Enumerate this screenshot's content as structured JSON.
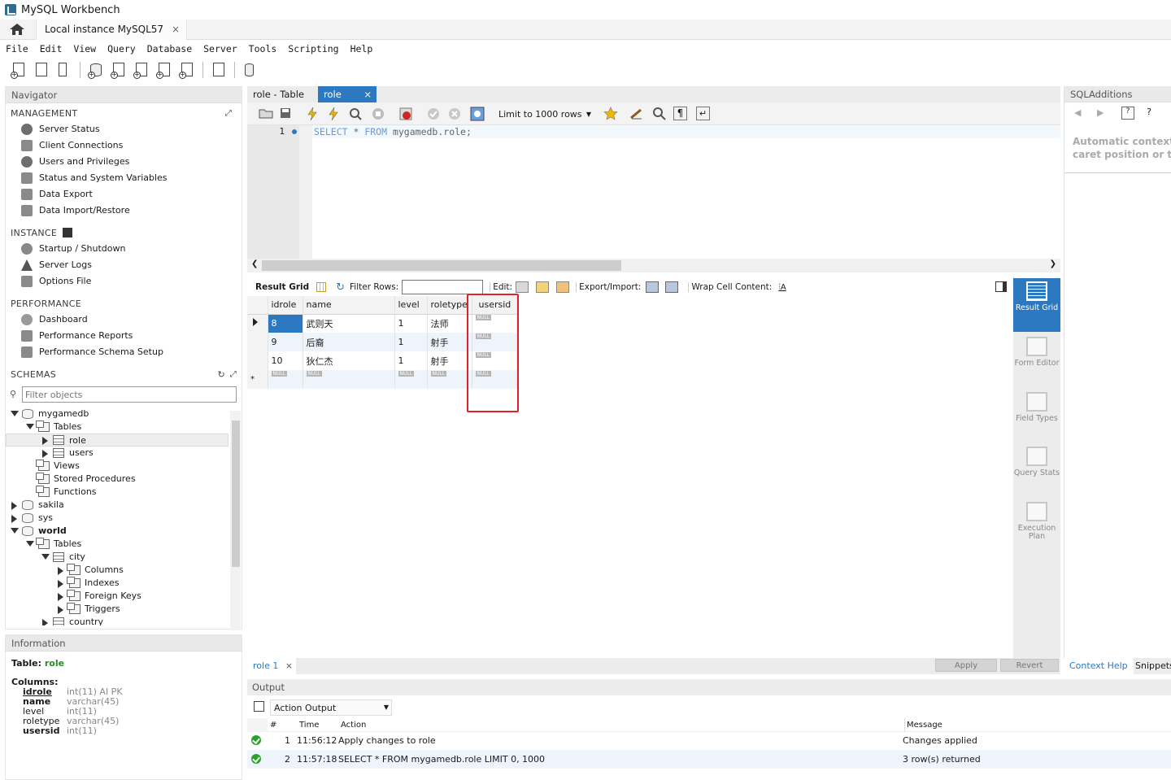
{
  "window": {
    "title": "MySQL Workbench"
  },
  "tabs": {
    "instance": "Local instance MySQL57",
    "close": "×"
  },
  "menu": [
    "File",
    "Edit",
    "View",
    "Query",
    "Database",
    "Server",
    "Tools",
    "Scripting",
    "Help"
  ],
  "navigator": {
    "title": "Navigator",
    "management": {
      "label": "MANAGEMENT",
      "items": [
        "Server Status",
        "Client Connections",
        "Users and Privileges",
        "Status and System Variables",
        "Data Export",
        "Data Import/Restore"
      ]
    },
    "instance": {
      "label": "INSTANCE",
      "items": [
        "Startup / Shutdown",
        "Server Logs",
        "Options File"
      ]
    },
    "performance": {
      "label": "PERFORMANCE",
      "items": [
        "Dashboard",
        "Performance Reports",
        "Performance Schema Setup"
      ]
    },
    "schemas": {
      "label": "SCHEMAS",
      "filter_placeholder": "Filter objects",
      "tree": [
        "mygamedb",
        "Tables",
        "role",
        "users",
        "Views",
        "Stored Procedures",
        "Functions",
        "sakila",
        "sys",
        "world",
        "Tables",
        "city",
        "Columns",
        "Indexes",
        "Foreign Keys",
        "Triggers",
        "country"
      ]
    }
  },
  "information": {
    "title": "Information",
    "table_label": "Table:",
    "table_name": "role",
    "columns_label": "Columns:",
    "columns": [
      {
        "name": "idrole",
        "type": "int(11) AI PK"
      },
      {
        "name": "name",
        "type": "varchar(45)"
      },
      {
        "name": "level",
        "type": "int(11)"
      },
      {
        "name": "roletype",
        "type": "varchar(45)"
      },
      {
        "name": "usersid",
        "type": "int(11)"
      }
    ]
  },
  "query_tabs": [
    "role - Table",
    "role"
  ],
  "query_toolbar": {
    "limit": "Limit to 1000 rows"
  },
  "editor": {
    "line": "1",
    "sql_kw1": "SELECT",
    "sql_mid": " * ",
    "sql_kw2": "FROM",
    "sql_rest": " mygamedb.role;"
  },
  "result_toolbar": {
    "result_grid": "Result Grid",
    "filter_rows": "Filter Rows:",
    "edit": "Edit:",
    "export_import": "Export/Import:",
    "wrap": "Wrap Cell Content:"
  },
  "grid": {
    "columns": [
      "idrole",
      "name",
      "level",
      "roletype",
      "usersid"
    ],
    "rows": [
      [
        "8",
        "武则天",
        "1",
        "法师",
        "NULL"
      ],
      [
        "9",
        "后裔",
        "1",
        "射手",
        "NULL"
      ],
      [
        "10",
        "狄仁杰",
        "1",
        "射手",
        "NULL"
      ]
    ],
    "null_label": "NULL"
  },
  "result_side": [
    "Result Grid",
    "Form Editor",
    "Field Types",
    "Query Stats",
    "Execution Plan"
  ],
  "result_bottom": {
    "tab": "role 1",
    "apply": "Apply",
    "revert": "Revert"
  },
  "sqladditions": {
    "title": "SQLAdditions",
    "text1": "Automatic context",
    "text2": "caret position or t",
    "context_help": "Context Help",
    "snippets": "Snippets"
  },
  "output": {
    "title": "Output",
    "selector": "Action Output",
    "headers": [
      "#",
      "Time",
      "Action",
      "Message"
    ],
    "rows": [
      {
        "n": "1",
        "time": "11:56:12",
        "action": "Apply changes to role",
        "message": "Changes applied"
      },
      {
        "n": "2",
        "time": "11:57:18",
        "action": "SELECT * FROM mygamedb.role LIMIT 0, 1000",
        "message": "3 row(s) returned"
      }
    ]
  }
}
